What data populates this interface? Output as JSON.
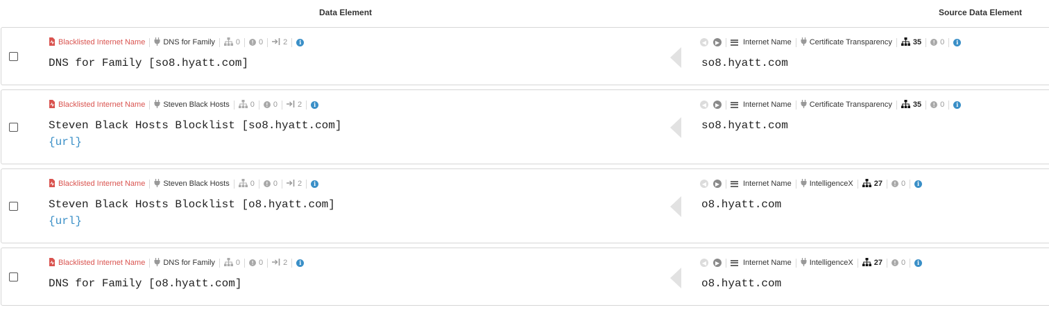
{
  "header": {
    "data_element": "Data Element",
    "source_data_element": "Source Data Element"
  },
  "colors": {
    "accent": "#3a8fc7",
    "danger": "#d9534f",
    "muted": "#999999"
  },
  "rows": [
    {
      "type_label": "Blacklisted Internet Name",
      "module": "DNS for Family",
      "children": "0",
      "flags": "0",
      "links": "2",
      "data": "DNS for Family [so8.hyatt.com]",
      "url": "",
      "source": {
        "type_label": "Internet Name",
        "module": "Certificate Transparency",
        "children": "35",
        "flags": "0",
        "data": "so8.hyatt.com"
      }
    },
    {
      "type_label": "Blacklisted Internet Name",
      "module": "Steven Black Hosts",
      "children": "0",
      "flags": "0",
      "links": "2",
      "data": "Steven Black Hosts Blocklist [so8.hyatt.com]",
      "url": "{url}",
      "source": {
        "type_label": "Internet Name",
        "module": "Certificate Transparency",
        "children": "35",
        "flags": "0",
        "data": "so8.hyatt.com"
      }
    },
    {
      "type_label": "Blacklisted Internet Name",
      "module": "Steven Black Hosts",
      "children": "0",
      "flags": "0",
      "links": "2",
      "data": "Steven Black Hosts Blocklist [o8.hyatt.com]",
      "url": "{url}",
      "source": {
        "type_label": "Internet Name",
        "module": "IntelligenceX",
        "children": "27",
        "flags": "0",
        "data": "o8.hyatt.com"
      }
    },
    {
      "type_label": "Blacklisted Internet Name",
      "module": "DNS for Family",
      "children": "0",
      "flags": "0",
      "links": "2",
      "data": "DNS for Family [o8.hyatt.com]",
      "url": "",
      "source": {
        "type_label": "Internet Name",
        "module": "IntelligenceX",
        "children": "27",
        "flags": "0",
        "data": "o8.hyatt.com"
      }
    }
  ]
}
